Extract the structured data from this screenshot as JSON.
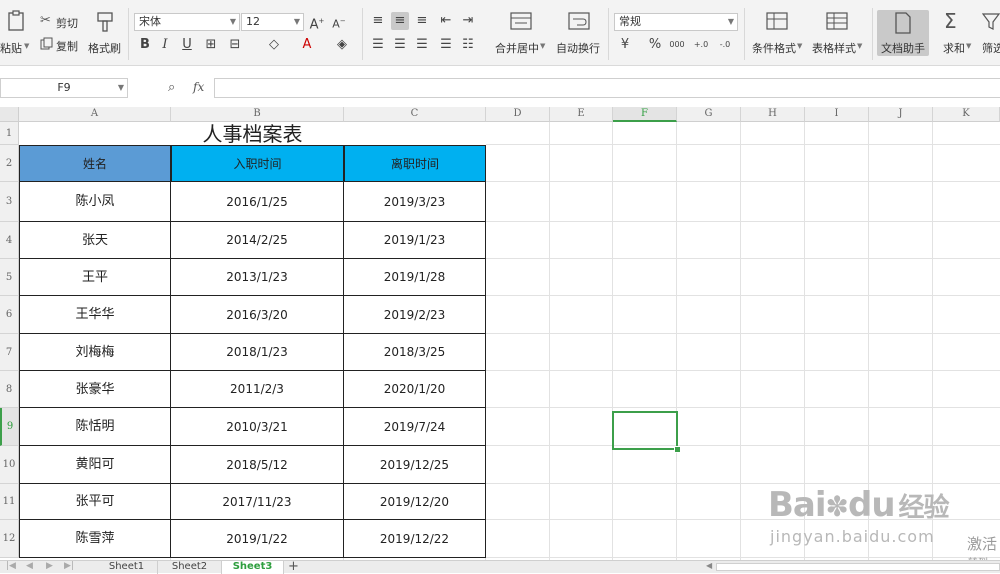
{
  "ribbon": {
    "paste": "粘贴",
    "cut": "剪切",
    "copy": "复制",
    "format_painter": "格式刷",
    "font_name": "宋体",
    "font_size": "12",
    "bold": "B",
    "italic": "I",
    "underline": "U",
    "merge_center": "合并居中",
    "wrap_text": "自动换行",
    "number_format": "常规",
    "percent": "%",
    "thousands": "000",
    "inc_decimal": "+.0",
    "dec_decimal": "-.0",
    "conditional_format": "条件格式",
    "table_style": "表格样式",
    "doc_assistant": "文档助手",
    "sum": "求和",
    "filter": "筛选"
  },
  "formula_bar": {
    "cell_ref": "F9",
    "fx": "fx",
    "value": ""
  },
  "columns": [
    "A",
    "B",
    "C",
    "D",
    "E",
    "F",
    "G",
    "H",
    "I",
    "J",
    "K"
  ],
  "rows": [
    "1",
    "2",
    "3",
    "4",
    "5",
    "6",
    "7",
    "8",
    "9",
    "10",
    "11",
    "12"
  ],
  "table": {
    "title": "人事档案表",
    "headers": [
      "姓名",
      "入职时间",
      "离职时间"
    ],
    "records": [
      [
        "陈小凤",
        "2016/1/25",
        "2019/3/23"
      ],
      [
        "张天",
        "2014/2/25",
        "2019/1/23"
      ],
      [
        "王平",
        "2013/1/23",
        "2019/1/28"
      ],
      [
        "王华华",
        "2016/3/20",
        "2019/2/23"
      ],
      [
        "刘梅梅",
        "2018/1/23",
        "2018/3/25"
      ],
      [
        "张豪华",
        "2011/2/3",
        "2020/1/20"
      ],
      [
        "陈恬明",
        "2010/3/21",
        "2019/7/24"
      ],
      [
        "黄阳可",
        "2018/5/12",
        "2019/12/25"
      ],
      [
        "张平可",
        "2017/11/23",
        "2019/12/20"
      ],
      [
        "陈雪萍",
        "2019/1/22",
        "2019/12/22"
      ]
    ]
  },
  "sheets": [
    "Sheet1",
    "Sheet2",
    "Sheet3"
  ],
  "active_sheet": "Sheet3",
  "selected_row": "9",
  "selected_col": "F",
  "watermark": {
    "brand": "Bai",
    "brand2": "du",
    "brand_cn": "经验",
    "url": "jingyan.baidu.com",
    "activate": "激活",
    "activate_sub": "转到"
  },
  "colors": {
    "header_name_bg": "#5b9bd5",
    "header_date_bg": "#00b0f0",
    "selection": "#3c9f4a"
  }
}
